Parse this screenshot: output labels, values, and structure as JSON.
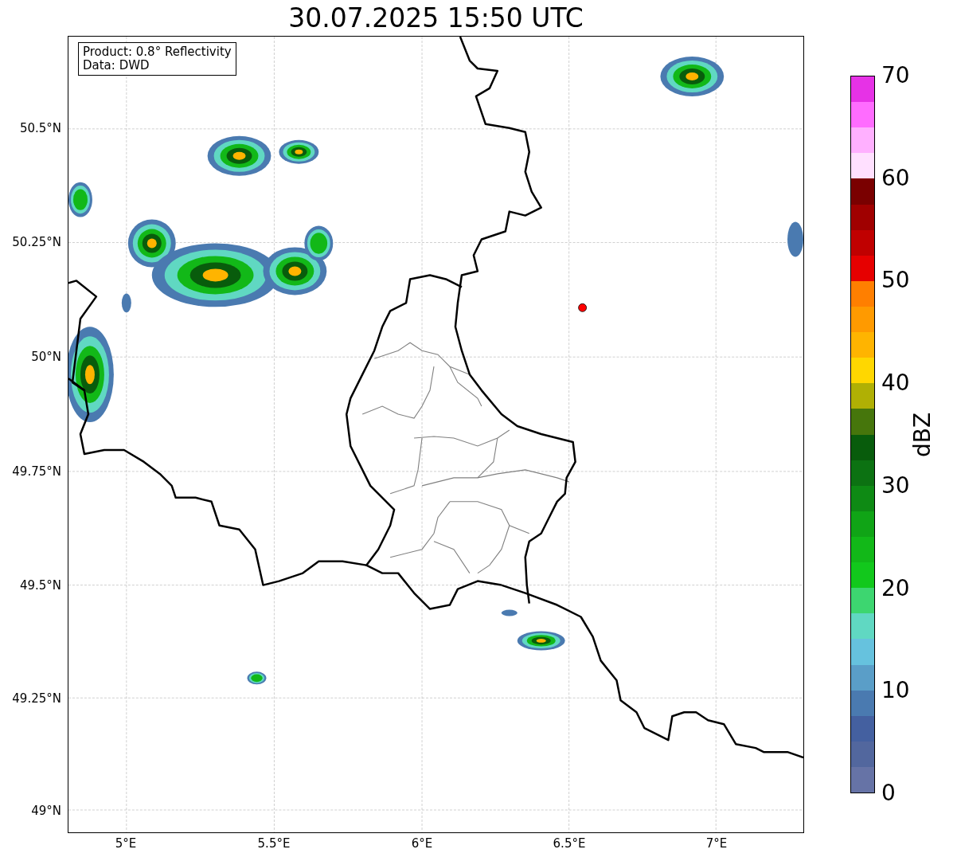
{
  "title": "30.07.2025 15:50 UTC",
  "legend": [
    "Product: 0.8° Reflectivity",
    "Data: DWD"
  ],
  "lat_ticks": [
    "50.5°N",
    "50.25°N",
    "50°N",
    "49.75°N",
    "49.5°N",
    "49.25°N",
    "49°N"
  ],
  "lon_ticks": [
    "5°E",
    "5.5°E",
    "6°E",
    "6.5°E",
    "7°E"
  ],
  "colorbar": {
    "label": "dBZ",
    "ticks": [
      "70",
      "60",
      "50",
      "40",
      "30",
      "20",
      "10",
      "0"
    ],
    "bins": [
      {
        "color": "#e632e6"
      },
      {
        "color": "#ff6cff"
      },
      {
        "color": "#ffb0ff"
      },
      {
        "color": "#ffe0ff"
      },
      {
        "color": "#7a0000"
      },
      {
        "color": "#a00000"
      },
      {
        "color": "#c00000"
      },
      {
        "color": "#e60000"
      },
      {
        "color": "#ff7f00"
      },
      {
        "color": "#ff9a00"
      },
      {
        "color": "#ffb400"
      },
      {
        "color": "#ffd700"
      },
      {
        "color": "#b0b004"
      },
      {
        "color": "#46760c"
      },
      {
        "color": "#085c0c"
      },
      {
        "color": "#0c7212"
      },
      {
        "color": "#0e8a14"
      },
      {
        "color": "#10a416"
      },
      {
        "color": "#12b818"
      },
      {
        "color": "#12c81c"
      },
      {
        "color": "#3dd670"
      },
      {
        "color": "#60d8c2"
      },
      {
        "color": "#66c2de"
      },
      {
        "color": "#5a9ec8"
      },
      {
        "color": "#4a7ab0"
      },
      {
        "color": "#4460a0"
      },
      {
        "color": "#52679e"
      },
      {
        "color": "#6673a6"
      }
    ]
  }
}
